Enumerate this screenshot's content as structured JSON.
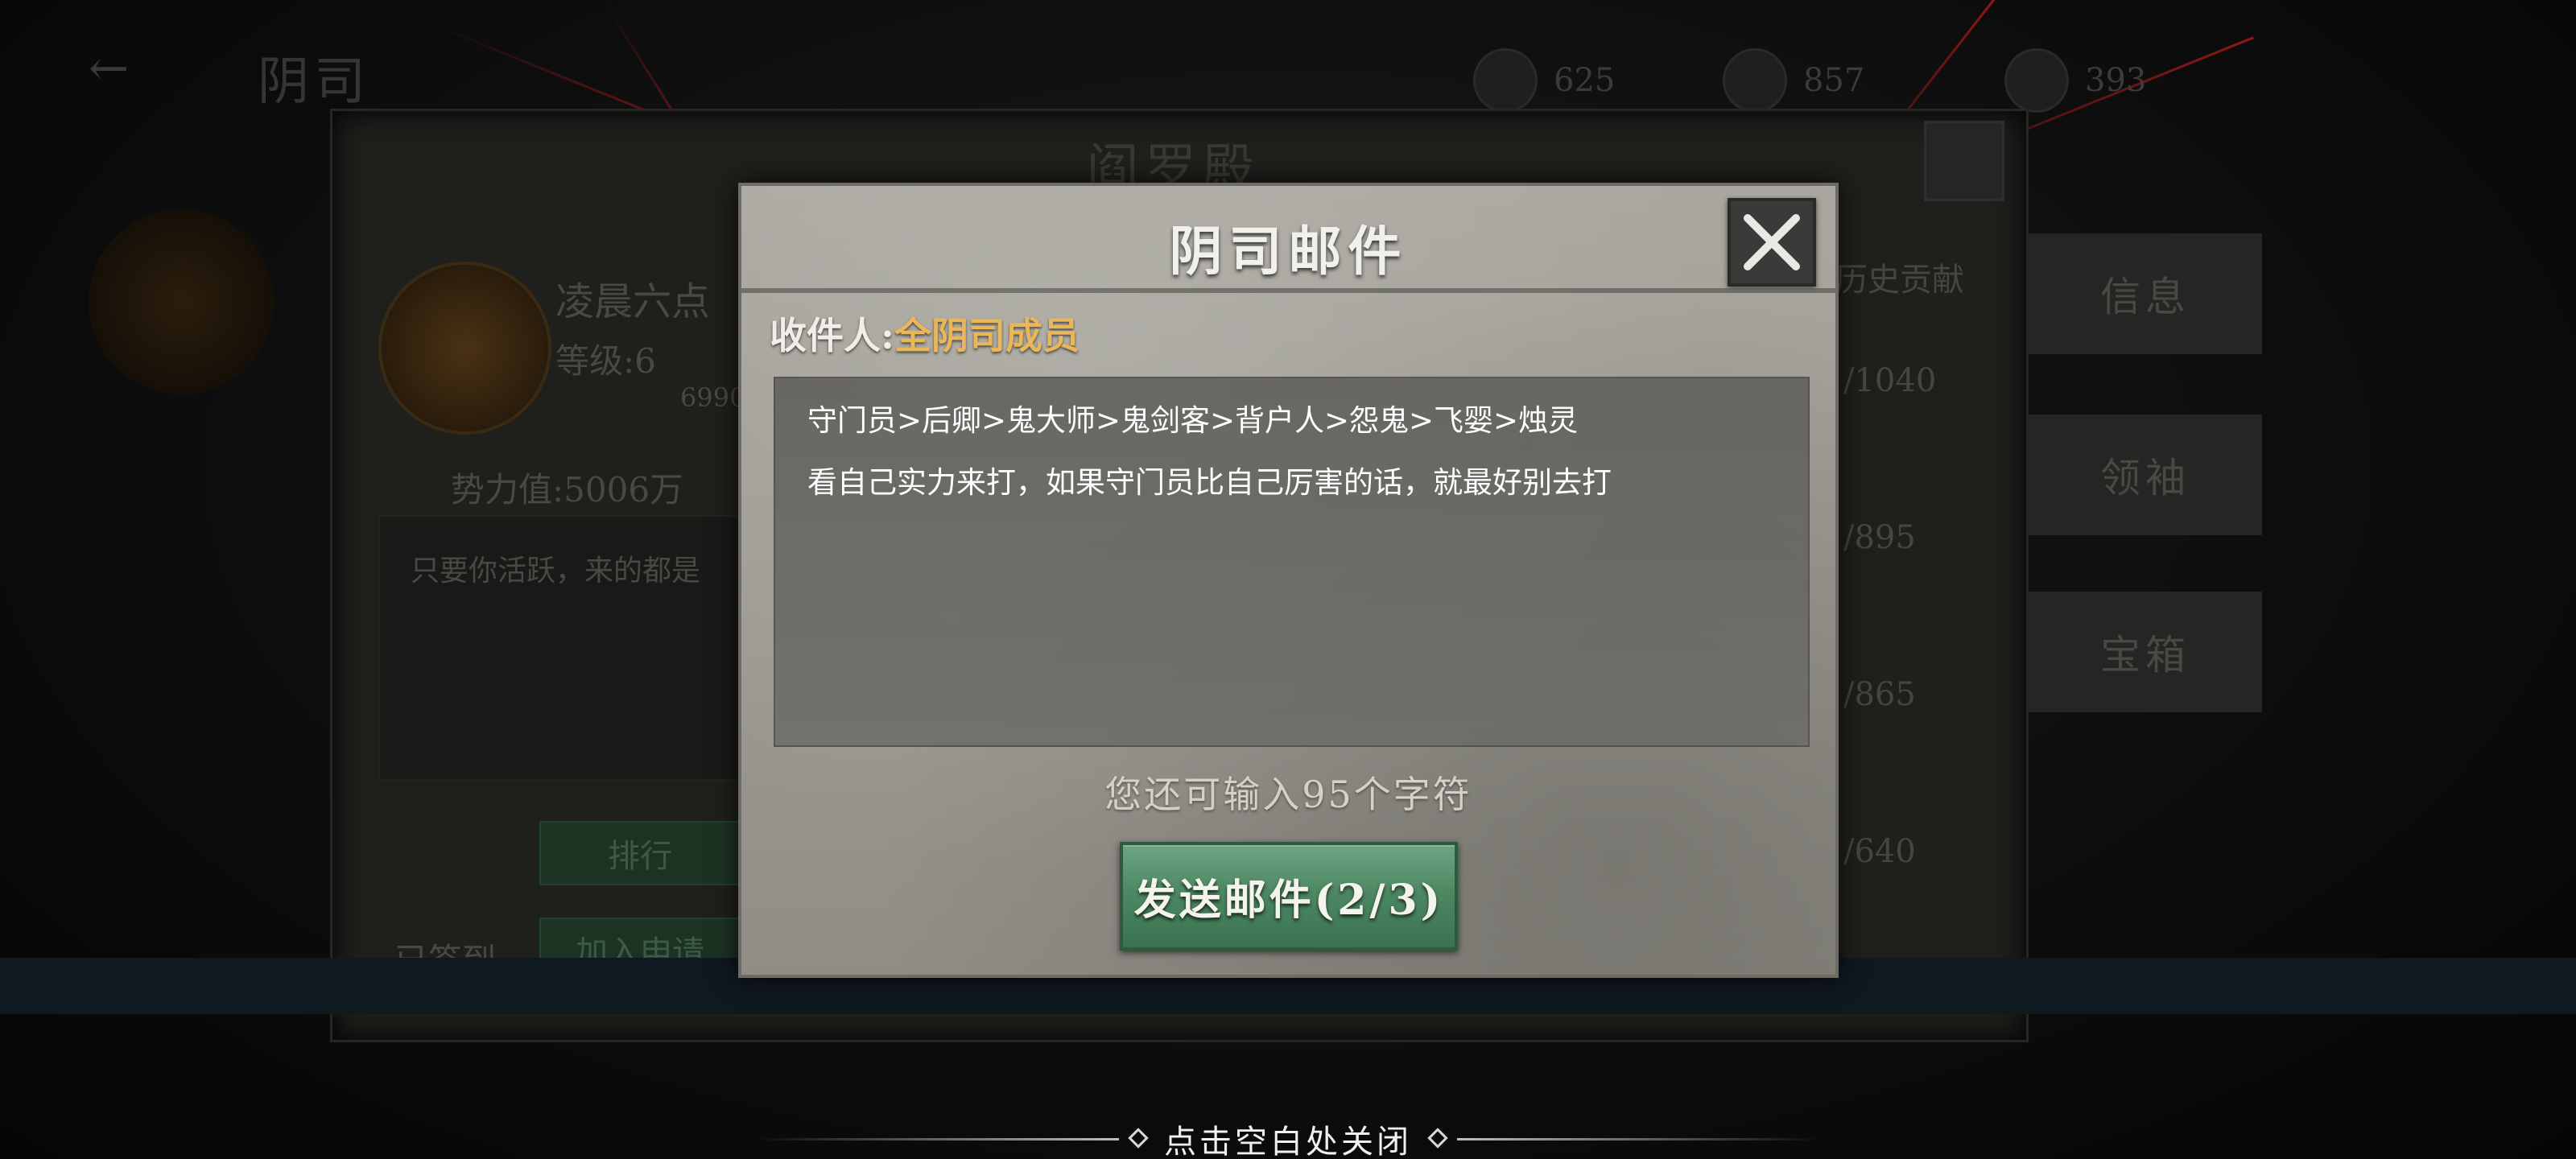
{
  "background": {
    "top_title": "阴司",
    "resources": [
      "625",
      "857",
      "393"
    ],
    "panel_title": "阎罗殿",
    "guild_name": "凌晨六点",
    "level": "等级:6",
    "exp": "6990",
    "power": "势力值:5006万",
    "notice": "只要你活跃，来的都是",
    "signed_in": "已签到",
    "rank_button": "排行",
    "join_button": "加入申请",
    "history_header": "历史贡献",
    "history_values": [
      "/1040",
      "/895",
      "/865",
      "/640"
    ],
    "side_tabs": [
      "信息",
      "领袖",
      "宝箱"
    ]
  },
  "dialog": {
    "title": "阴司邮件",
    "recipient_label": "收件人:",
    "recipient_value": "全阴司成员",
    "body_lines": [
      "守门员>后卿>鬼大师>鬼剑客>背户人>怨鬼>飞婴>烛灵",
      "看自己实力来打，如果守门员比自己厉害的话，就最好别去打"
    ],
    "char_count": "您还可输入95个字符",
    "send_button": "发送邮件(2/3)"
  },
  "hint": {
    "text": "点击空白处关闭"
  }
}
